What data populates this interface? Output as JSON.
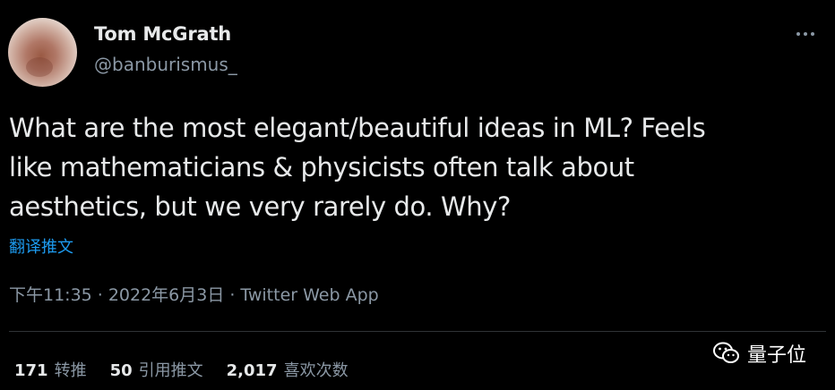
{
  "author": {
    "name": "Tom McGrath",
    "handle": "@banburismus_",
    "avatar_icon": "avatar-photo"
  },
  "tweet": {
    "text_lines": [
      "What are the most elegant/beautiful ideas in ML? Feels",
      "like mathematicians & physicists often talk about",
      "aesthetics, but we very rarely do. Why?"
    ],
    "translate_label": "翻译推文",
    "time": "下午11:35",
    "separator": "·",
    "date": "2022年6月3日",
    "source": "Twitter Web App"
  },
  "stats": {
    "retweets_count": "171",
    "retweets_label": "转推",
    "quotes_count": "50",
    "quotes_label": "引用推文",
    "likes_count": "2,017",
    "likes_label": "喜欢次数"
  },
  "watermark": {
    "text": "量子位",
    "icon": "wechat-icon"
  },
  "colors": {
    "background": "#000000",
    "text": "#e7e9ea",
    "muted": "#8b98a5",
    "link": "#1d9bf0",
    "divider": "#2f3336"
  },
  "icons": {
    "more": "more-horizontal-icon"
  }
}
